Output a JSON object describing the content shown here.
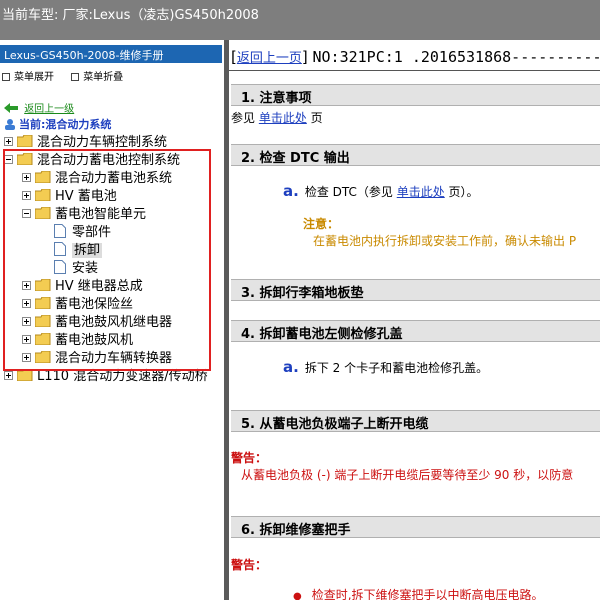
{
  "window": {
    "title": "当前车型:  厂家:Lexus（凌志)GS450h2008"
  },
  "left_panel": {
    "manual_title": "Lexus-GS450h-2008-维修手册",
    "menu": {
      "expand": "菜单展开",
      "collapse": "菜单折叠"
    },
    "back_link": "返回上一级",
    "current": "当前:混合动力系统",
    "tree": {
      "n0": "混合动力车辆控制系统",
      "n1": "混合动力蓄电池控制系统",
      "n2": "混合动力蓄电池系统",
      "n3": "HV 蓄电池",
      "n4": "蓄电池智能单元",
      "n5": "零部件",
      "n6": "拆卸",
      "n7": "安装",
      "n8": "HV 继电器总成",
      "n9": "蓄电池保险丝",
      "n10": "蓄电池鼓风机继电器",
      "n11": "蓄电池鼓风机",
      "n12": "混合动力车辆转换器",
      "n13": "L110 混合动力变速器/传动桥"
    }
  },
  "content": {
    "back_link": "返回上一页",
    "doc_number": "NO:321PC:1 .2016531868------------",
    "sections": {
      "s1": {
        "title": "1. 注意事项",
        "pre": "参见 ",
        "link": "单击此处",
        "post": " 页"
      },
      "s2": {
        "title": "2. 检查 DTC 输出",
        "step_marker": "a.",
        "step_pre": "检查 DTC（参见 ",
        "step_link": "单击此处",
        "step_post": " 页）。",
        "note_title": "注意：",
        "note_text": "在蓄电池内执行拆卸或安装工作前，确认未输出 P"
      },
      "s3": {
        "title": "3. 拆卸行李箱地板垫"
      },
      "s4": {
        "title": "4. 拆卸蓄电池左侧检修孔盖",
        "step_marker": "a.",
        "step_text": "拆下 2 个卡子和蓄电池检修孔盖。"
      },
      "s5": {
        "title": "5. 从蓄电池负极端子上断开电缆",
        "warn_title": "警告：",
        "warn_text": "从蓄电池负极 (-) 端子上断开电缆后要等待至少 90 秒，以防意"
      },
      "s6": {
        "title": "6. 拆卸维修塞把手",
        "warn_title": "警告：",
        "bullet_text": "检查时,拆下维修塞把手以中断高电压电路。"
      }
    }
  },
  "colors": {
    "title_bar": "#7e7e7e",
    "manual_title_bg": "#1d66b2",
    "link": "#1d3fbf",
    "note": "#c98a00",
    "warning": "#cc1111",
    "highlight_box": "#e02020"
  },
  "icons": [
    "folder-icon",
    "page-icon",
    "back-arrow-icon",
    "user-icon",
    "expand-toggle-icon",
    "collapse-toggle-icon",
    "menu-square-icon"
  ]
}
